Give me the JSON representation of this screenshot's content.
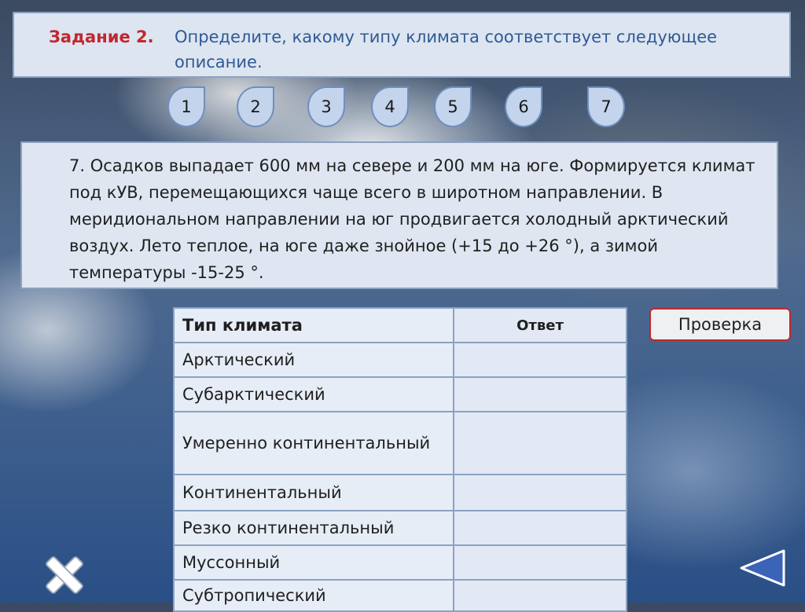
{
  "task": {
    "label": "Задание 2.",
    "text": "Определите, какому типу климата соответствует следующее описание."
  },
  "nav_drops": [
    "1",
    "2",
    "3",
    "4",
    "5",
    "6",
    "7"
  ],
  "description": "7. Осадков выпадает 600 мм на севере и 200 мм на юге. Формируется климат под кУВ, перемещающихся чаще всего в широтном направлении. В меридиональном направлении на юг продвигается холодный арктический воздух. Лето теплое, на юге даже знойное (+15 до +26 °), а зимой температуры  -15-25 °.",
  "table": {
    "header_type": "Тип климата",
    "header_answer": "Ответ",
    "rows": [
      "Арктический",
      "Субарктический",
      "Умеренно континентальный",
      "Континентальный",
      "Резко континентальный",
      "Муссонный",
      "Субтропический"
    ]
  },
  "check_button": "Проверка",
  "icons": {
    "close": "close-icon",
    "back": "back-arrow-icon"
  },
  "colors": {
    "accent_red": "#c0282d",
    "title_blue": "#2f5a94",
    "panel": "#dde5f1"
  }
}
